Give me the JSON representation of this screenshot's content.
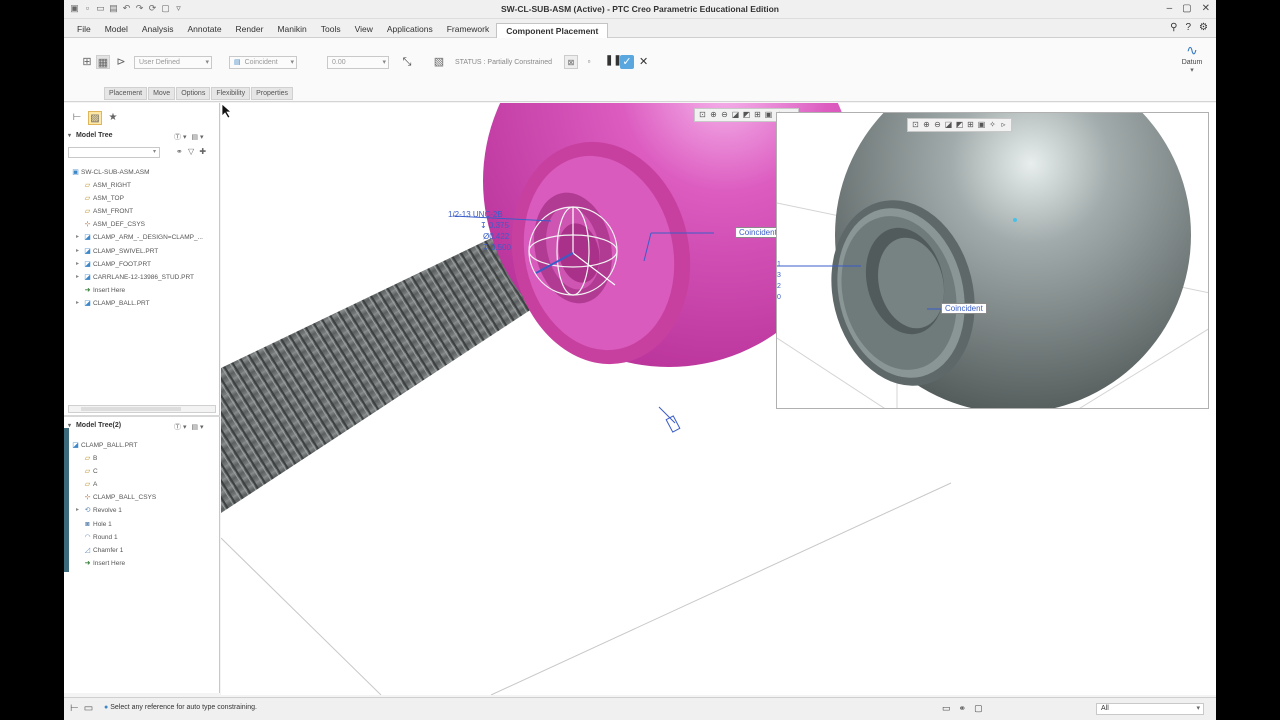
{
  "window": {
    "title": "SW-CL-SUB-ASM (Active) - PTC Creo Parametric Educational Edition"
  },
  "menu": {
    "tabs": [
      "File",
      "Model",
      "Analysis",
      "Annotate",
      "Render",
      "Manikin",
      "Tools",
      "View",
      "Applications",
      "Framework",
      "Component Placement"
    ],
    "active_tab": "Component Placement"
  },
  "ribbon": {
    "constraint_set": "User Defined",
    "constraint_type": "Coincident",
    "offset_value": "0.00",
    "status_label": "STATUS : Partially Constrained",
    "datum_label": "Datum",
    "subtabs": [
      "Placement",
      "Move",
      "Options",
      "Flexibility",
      "Properties"
    ]
  },
  "model_tree": {
    "title": "Model Tree",
    "search_value": "",
    "items": [
      {
        "label": "SW-CL-SUB-ASM.ASM",
        "icon": "assembly-icon",
        "expander": ""
      },
      {
        "label": "ASM_RIGHT",
        "icon": "datum-plane-icon",
        "expander": ""
      },
      {
        "label": "ASM_TOP",
        "icon": "datum-plane-icon",
        "expander": ""
      },
      {
        "label": "ASM_FRONT",
        "icon": "datum-plane-icon",
        "expander": ""
      },
      {
        "label": "ASM_DEF_CSYS",
        "icon": "csys-icon",
        "expander": ""
      },
      {
        "label": "CLAMP_ARM_-_DESIGN=CLAMP_...",
        "icon": "part-icon",
        "expander": "▸"
      },
      {
        "label": "CLAMP_SWIVEL.PRT",
        "icon": "part-icon",
        "expander": "▸"
      },
      {
        "label": "CLAMP_FOOT.PRT",
        "icon": "part-icon",
        "expander": "▸"
      },
      {
        "label": "CARRLANE-12-13986_STUD.PRT",
        "icon": "part-icon",
        "expander": "▸"
      },
      {
        "label": "Insert Here",
        "icon": "insert-icon",
        "expander": ""
      },
      {
        "label": "CLAMP_BALL.PRT",
        "icon": "part-icon",
        "expander": "▸"
      }
    ]
  },
  "model_tree_2": {
    "title": "Model Tree(2)",
    "items": [
      {
        "label": "CLAMP_BALL.PRT",
        "icon": "part-icon",
        "expander": ""
      },
      {
        "label": "B",
        "icon": "datum-plane-icon",
        "expander": ""
      },
      {
        "label": "C",
        "icon": "datum-plane-icon",
        "expander": ""
      },
      {
        "label": "A",
        "icon": "datum-plane-icon",
        "expander": ""
      },
      {
        "label": "CLAMP_BALL_CSYS",
        "icon": "csys-icon",
        "expander": ""
      },
      {
        "label": "Revolve 1",
        "icon": "revolve-icon",
        "expander": "▸"
      },
      {
        "label": "Hole 1",
        "icon": "hole-icon",
        "expander": ""
      },
      {
        "label": "Round 1",
        "icon": "round-icon",
        "expander": ""
      },
      {
        "label": "Chamfer 1",
        "icon": "chamfer-icon",
        "expander": ""
      },
      {
        "label": "Insert Here",
        "icon": "insert-icon",
        "expander": ""
      }
    ]
  },
  "viewport": {
    "hole_callout": [
      "1/2-13 UNC-2B",
      "↧ 0.375",
      "Ø0.422",
      "↧ 0.500"
    ],
    "constraint_label_main": "Coincident",
    "constraint_label_sub": "Coincident",
    "sub_callout": [
      "1",
      "3",
      "2",
      "0"
    ]
  },
  "status": {
    "message": "Select any reference for auto type constraining.",
    "filter": "All"
  },
  "colors": {
    "ball_main": "#d04ab0",
    "ball_sub": "#6f7a7a",
    "stud": "#6c7070",
    "accent": "#3a5cc8",
    "ok_button": "#5aa7e0"
  }
}
